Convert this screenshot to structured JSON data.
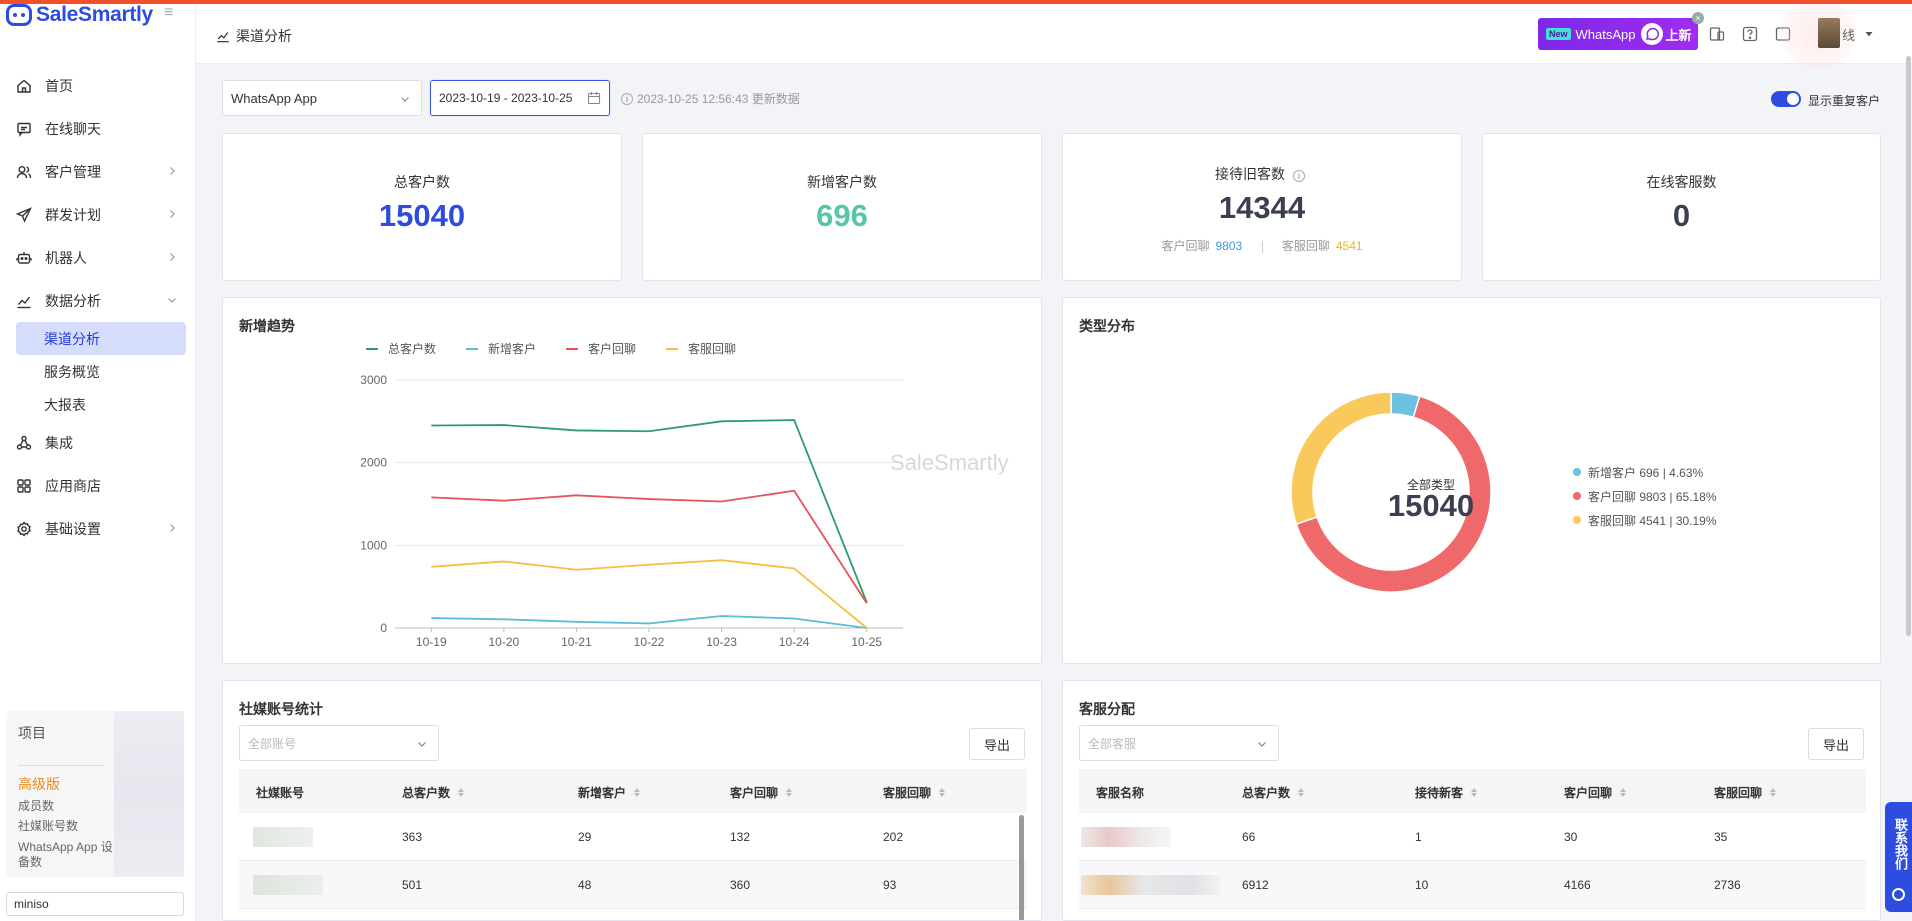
{
  "brand": {
    "name": "SaleSmartly"
  },
  "nav": {
    "items": [
      {
        "label": "首页"
      },
      {
        "label": "在线聊天"
      },
      {
        "label": "客户管理"
      },
      {
        "label": "群发计划"
      },
      {
        "label": "机器人"
      },
      {
        "label": "数据分析"
      },
      {
        "label": "集成"
      },
      {
        "label": "应用商店"
      },
      {
        "label": "基础设置"
      }
    ],
    "sub_items": [
      {
        "label": "渠道分析"
      },
      {
        "label": "服务概览"
      },
      {
        "label": "大报表"
      }
    ]
  },
  "project": {
    "title": "项目",
    "tier": "高级版",
    "lines": [
      "成员数",
      "社媒账号数",
      "WhatsApp App 设",
      "备数"
    ],
    "search_value": "miniso"
  },
  "header": {
    "breadcrumb": "渠道分析",
    "promo_new": "New",
    "promo_text": "WhatsApp",
    "promo_suffix": "上新",
    "status": "线"
  },
  "filters": {
    "channel": "WhatsApp App",
    "date_range": "2023-10-19 - 2023-10-25",
    "update_note": "2023-10-25 12:56:43 更新数据",
    "toggle_label": "显示重复客户"
  },
  "stats": [
    {
      "title": "总客户数",
      "value": "15040",
      "color": "#2c4de0"
    },
    {
      "title": "新增客户数",
      "value": "696",
      "color": "#55c6a8"
    },
    {
      "title": "接待旧客数",
      "value": "14344",
      "color": "#3a3f52",
      "sub_a_label": "客户回聊",
      "sub_a_value": "9803",
      "sub_b_label": "客服回聊",
      "sub_b_value": "4541"
    },
    {
      "title": "在线客服数",
      "value": "0",
      "color": "#3a3f52"
    }
  ],
  "trend": {
    "title": "新增趋势",
    "watermark": "SaleSmartly"
  },
  "dist": {
    "title": "类型分布",
    "center_label": "全部类型",
    "center_value": "15040",
    "legend": [
      {
        "text": "新增客户 696 | 4.63%"
      },
      {
        "text": "客户回聊 9803 | 65.18%"
      },
      {
        "text": "客服回聊 4541 | 30.19%"
      }
    ]
  },
  "chart_data": [
    {
      "type": "line",
      "x": [
        "10-19",
        "10-20",
        "10-21",
        "10-22",
        "10-23",
        "10-24",
        "10-25"
      ],
      "ylim": [
        0,
        3000
      ],
      "y_ticks": [
        "0",
        "1000",
        "2000",
        "3000"
      ],
      "grid": true,
      "legend_position": "top",
      "series": [
        {
          "name": "总客户数",
          "color": "#2e9c6a",
          "values": [
            2450,
            2455,
            2390,
            2380,
            2500,
            2515,
            310
          ]
        },
        {
          "name": "新增客户",
          "color": "#5bbcd6",
          "values": [
            120,
            105,
            75,
            55,
            145,
            115,
            0
          ]
        },
        {
          "name": "客户回聊",
          "color": "#e8535a",
          "values": [
            1580,
            1540,
            1605,
            1560,
            1530,
            1660,
            300
          ]
        },
        {
          "name": "客服回聊",
          "color": "#f5bf42",
          "values": [
            740,
            805,
            705,
            765,
            820,
            720,
            0
          ]
        }
      ]
    },
    {
      "type": "pie",
      "series": [
        {
          "name": "新增客户",
          "value": 696,
          "color": "#6cc0e0"
        },
        {
          "name": "客户回聊",
          "value": 9803,
          "color": "#f0696a"
        },
        {
          "name": "客服回聊",
          "value": 4541,
          "color": "#f9c95c"
        }
      ]
    }
  ],
  "social_table": {
    "title": "社媒账号统计",
    "filter_placeholder": "全部账号",
    "export_label": "导出",
    "columns": [
      "社媒账号",
      "总客户数",
      "新增客户",
      "客户回聊",
      "客服回聊"
    ],
    "rows": [
      [
        "363",
        "29",
        "132",
        "202"
      ],
      [
        "501",
        "48",
        "360",
        "93"
      ]
    ]
  },
  "agent_table": {
    "title": "客服分配",
    "filter_placeholder": "全部客服",
    "export_label": "导出",
    "columns": [
      "客服名称",
      "总客户数",
      "接待新客",
      "客户回聊",
      "客服回聊"
    ],
    "rows": [
      [
        "66",
        "1",
        "30",
        "35"
      ],
      [
        "6912",
        "10",
        "4166",
        "2736"
      ]
    ]
  },
  "contact": {
    "label": "联系我们"
  }
}
